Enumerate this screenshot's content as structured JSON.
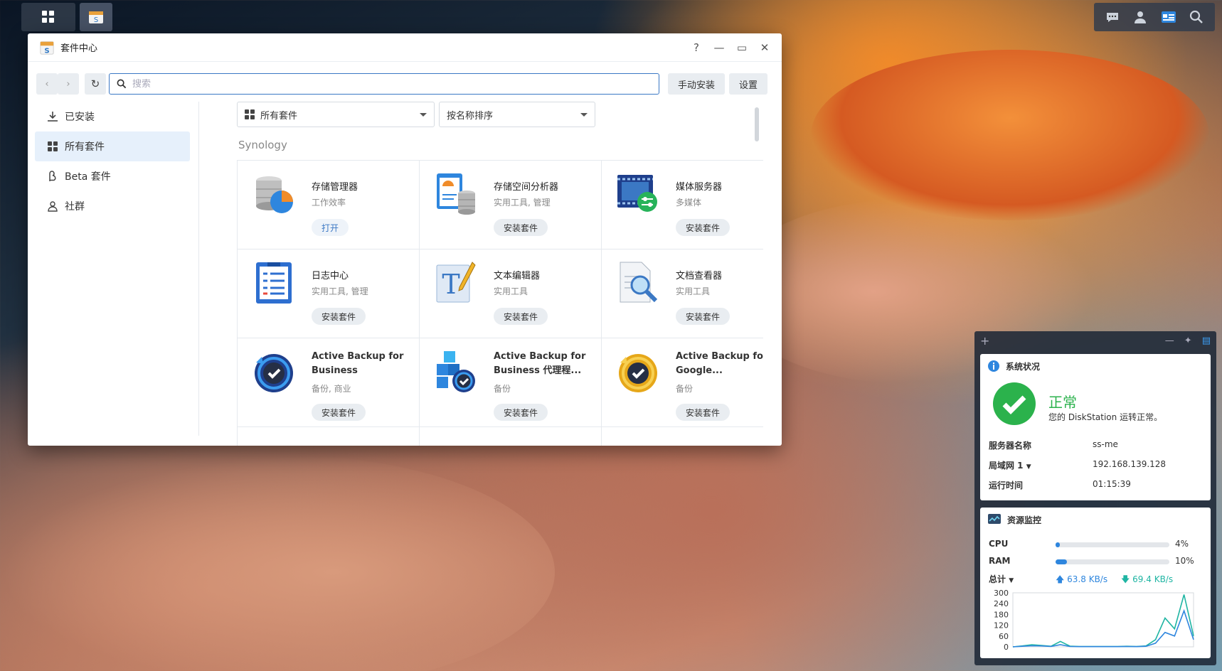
{
  "window": {
    "title": "套件中心",
    "help": "?",
    "minimize": "—",
    "maximize": "▭",
    "close": "✕"
  },
  "toolbar": {
    "search_placeholder": "搜索",
    "manual_install": "手动安装",
    "settings": "设置"
  },
  "sidebar": {
    "items": [
      {
        "label": "已安装",
        "icon": "download-icon"
      },
      {
        "label": "所有套件",
        "icon": "grid-icon"
      },
      {
        "label": "Beta 套件",
        "icon": "beta-icon"
      },
      {
        "label": "社群",
        "icon": "community-icon"
      }
    ]
  },
  "filters": {
    "category": "所有套件",
    "sort": "按名称排序"
  },
  "section_title": "Synology",
  "packages": [
    {
      "name": "存储管理器",
      "category": "工作效率",
      "action": "打开"
    },
    {
      "name": "存储空间分析器",
      "category": "实用工具, 管理",
      "action": "安装套件"
    },
    {
      "name": "媒体服务器",
      "category": "多媒体",
      "action": "安装套件"
    },
    {
      "name": "日志中心",
      "category": "实用工具, 管理",
      "action": "安装套件"
    },
    {
      "name": "文本编辑器",
      "category": "实用工具",
      "action": "安装套件"
    },
    {
      "name": "文档查看器",
      "category": "实用工具",
      "action": "安装套件"
    },
    {
      "name": "Active Backup for Business",
      "category": "备份, 商业",
      "action": "安装套件"
    },
    {
      "name": "Active Backup for Business 代理程...",
      "category": "备份",
      "action": "安装套件"
    },
    {
      "name": "Active Backup for Google...",
      "category": "备份",
      "action": "安装套件"
    }
  ],
  "widget_status": {
    "title": "系统状况",
    "state": "正常",
    "message": "您的 DiskStation 运转正常。",
    "server_name_label": "服务器名称",
    "server_name": "ss-me",
    "lan_label": "局域网 1",
    "lan_ip": "192.168.139.128",
    "uptime_label": "运行时间",
    "uptime": "01:15:39"
  },
  "widget_resource": {
    "title": "资源监控",
    "cpu_label": "CPU",
    "cpu_value": "4%",
    "cpu_pct": 4,
    "ram_label": "RAM",
    "ram_value": "10%",
    "ram_pct": 10,
    "total_label": "总计",
    "upload": "63.8 KB/s",
    "download": "69.4 KB/s",
    "yticks": [
      "300",
      "240",
      "180",
      "120",
      "60",
      "0"
    ]
  },
  "chart_data": {
    "type": "line",
    "ylim": [
      0,
      300
    ],
    "series": [
      {
        "values": [
          0,
          5,
          12,
          8,
          3,
          30,
          4,
          2,
          2,
          2,
          2,
          2,
          3,
          2,
          5,
          40,
          160,
          100,
          290,
          60
        ]
      },
      {
        "values": [
          0,
          3,
          6,
          5,
          2,
          12,
          2,
          1,
          1,
          1,
          1,
          1,
          2,
          1,
          3,
          20,
          80,
          60,
          200,
          40
        ]
      }
    ]
  },
  "colors": {
    "accent": "#3b78c4",
    "ok_green": "#2bb24c",
    "upload_blue": "#2e86de",
    "download_teal": "#1fb5a3"
  }
}
